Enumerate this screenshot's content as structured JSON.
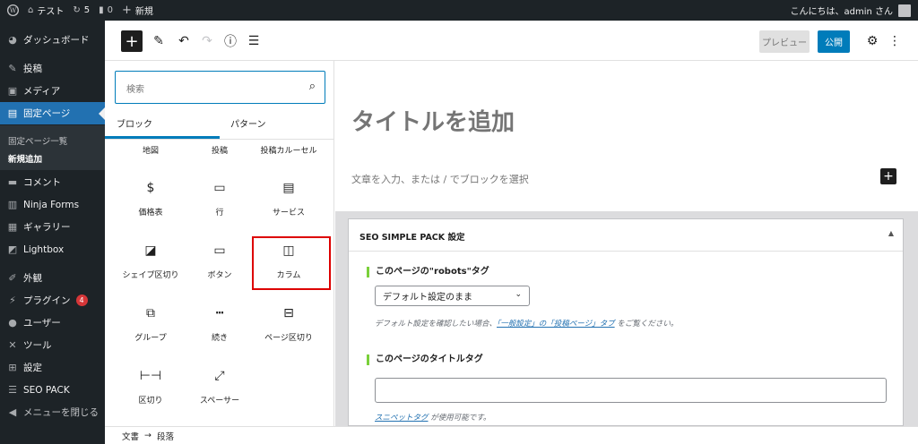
{
  "adminbar": {
    "site_name": "テスト",
    "updates_count": "5",
    "comments_count": "0",
    "new_label": "新規",
    "greeting": "こんにちは、admin さん"
  },
  "sidebar": {
    "items": [
      {
        "label": "ダッシュボード",
        "icon": "dashboard-icon"
      },
      {
        "label": "投稿",
        "icon": "pin-icon"
      },
      {
        "label": "メディア",
        "icon": "media-icon"
      },
      {
        "label": "固定ページ",
        "icon": "page-icon"
      },
      {
        "label": "コメント",
        "icon": "comment-icon"
      },
      {
        "label": "Ninja Forms",
        "icon": "form-icon"
      },
      {
        "label": "ギャラリー",
        "icon": "gallery-icon"
      },
      {
        "label": "Lightbox",
        "icon": "lightbox-icon"
      },
      {
        "label": "外観",
        "icon": "brush-icon"
      },
      {
        "label": "プラグイン",
        "icon": "plugin-icon",
        "badge": "4"
      },
      {
        "label": "ユーザー",
        "icon": "user-icon"
      },
      {
        "label": "ツール",
        "icon": "wrench-icon"
      },
      {
        "label": "設定",
        "icon": "settings-icon"
      },
      {
        "label": "SEO PACK",
        "icon": "list-icon"
      },
      {
        "label": "メニューを閉じる",
        "icon": "collapse-icon"
      }
    ],
    "submenu": [
      "固定ページ一覧",
      "新規追加"
    ]
  },
  "toolbar": {
    "preview_label": "プレビュー",
    "publish_label": "公開"
  },
  "inserter": {
    "search_placeholder": "検索",
    "tabs": [
      "ブロック",
      "パターン"
    ],
    "partial_row": [
      "地図",
      "投稿",
      "投稿カルーセル"
    ],
    "blocks": [
      {
        "label": "価格表",
        "icon": "pricing-table-icon"
      },
      {
        "label": "行",
        "icon": "row-icon"
      },
      {
        "label": "サービス",
        "icon": "service-icon"
      },
      {
        "label": "シェイプ区切り",
        "icon": "shape-divider-icon"
      },
      {
        "label": "ボタン",
        "icon": "button-block-icon"
      },
      {
        "label": "カラム",
        "icon": "columns-icon"
      },
      {
        "label": "グループ",
        "icon": "group-icon"
      },
      {
        "label": "続き",
        "icon": "more-icon"
      },
      {
        "label": "ページ区切り",
        "icon": "page-break-icon"
      },
      {
        "label": "区切り",
        "icon": "separator-icon"
      },
      {
        "label": "スペーサー",
        "icon": "spacer-icon"
      }
    ]
  },
  "editor": {
    "title_placeholder": "タイトルを追加",
    "paragraph_placeholder": "文章を入力、または / でブロックを選択"
  },
  "metabox": {
    "title": "SEO SIMPLE PACK 設定",
    "robots_label": "このページの\"robots\"タグ",
    "robots_value": "デフォルト設定のまま",
    "help_prefix": "デフォルト設定を確認したい場合、",
    "help_link": "「一般設定」の「投稿ページ」タブ",
    "help_suffix": "をご覧ください。",
    "title_tag_label": "このページのタイトルタグ",
    "title_tag_value": "",
    "snippet_link": "スニペットタグ",
    "snippet_suffix": "が使用可能です。"
  },
  "footer": {
    "crumb1": "文書",
    "arrow": "→",
    "crumb2": "段落"
  }
}
